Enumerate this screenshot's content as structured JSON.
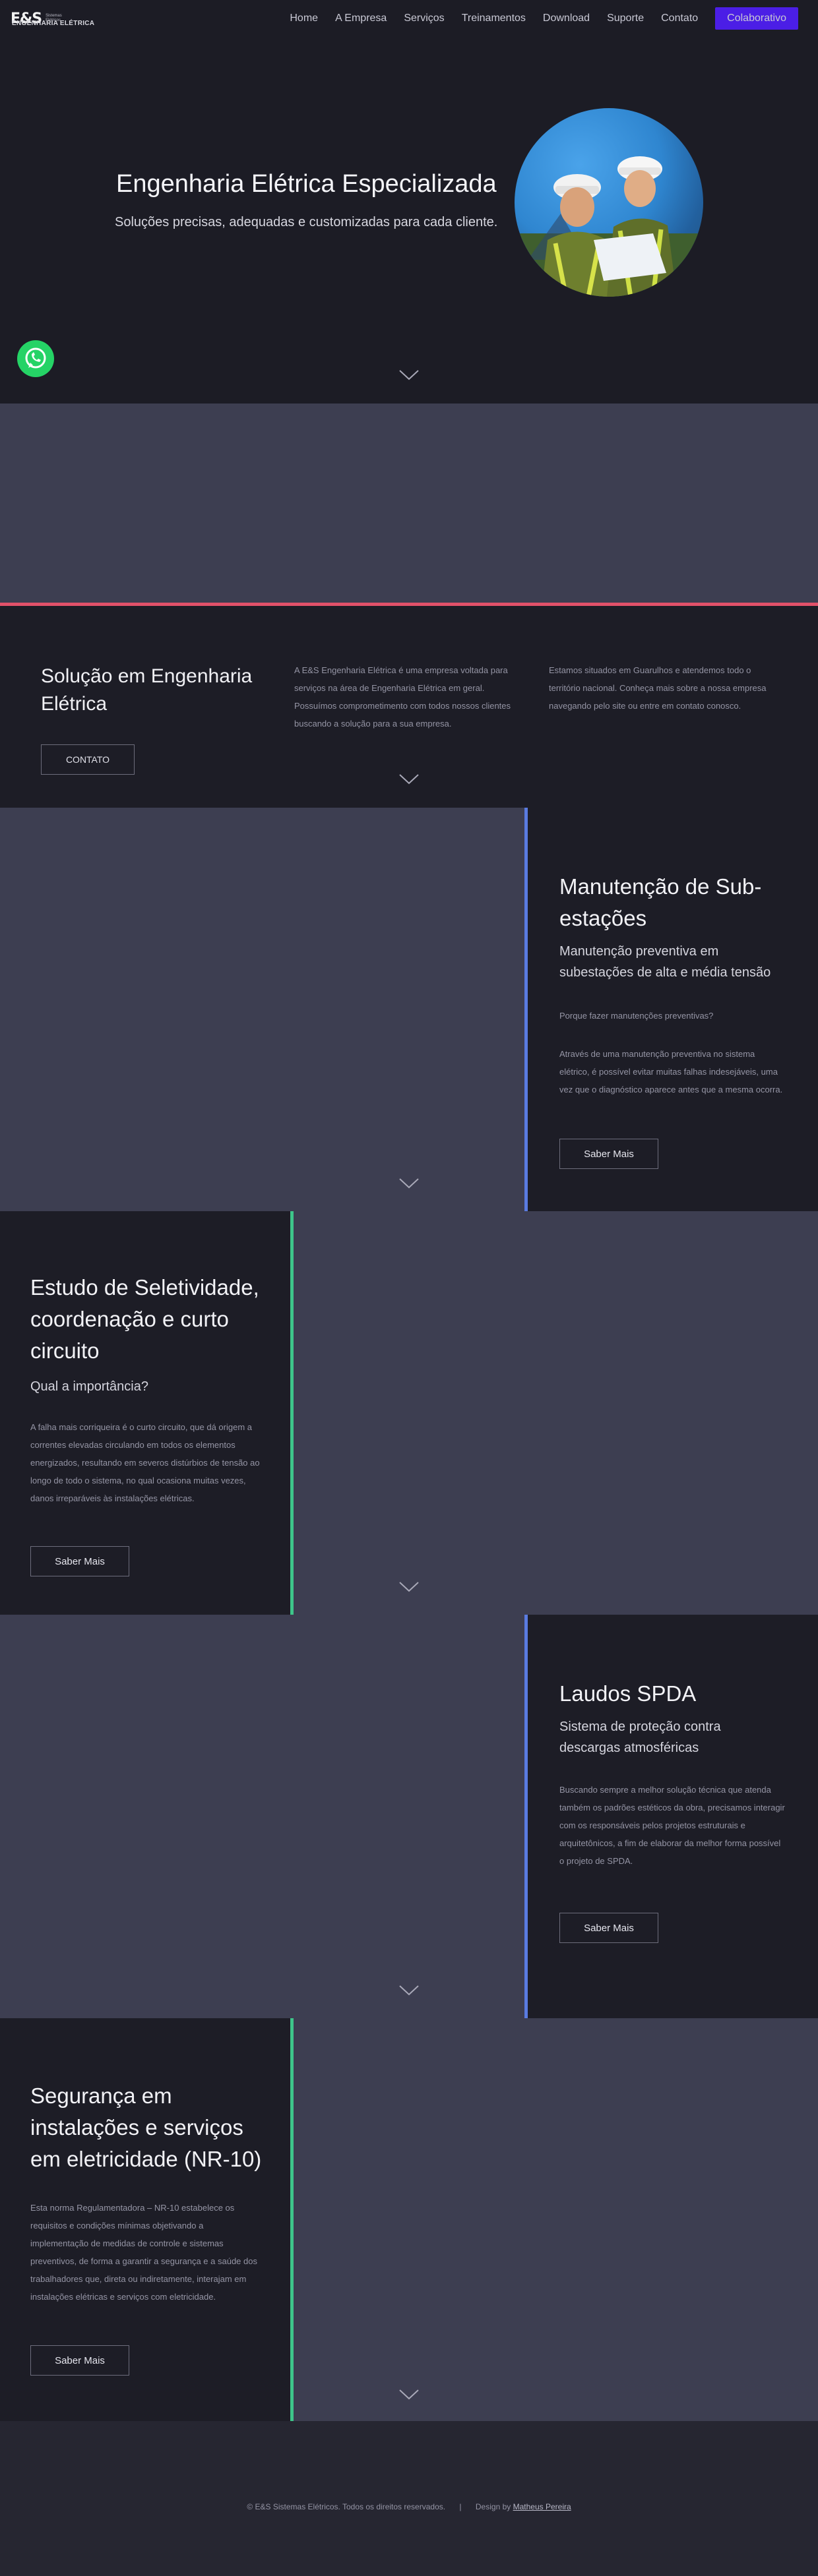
{
  "logo": {
    "mark": "E&S",
    "sub_line1": "Sistemas",
    "sub_line2": "Elétricos",
    "line": "ENGENHARIA ELÉTRICA"
  },
  "nav": {
    "items": [
      "Home",
      "A Empresa",
      "Serviços",
      "Treinamentos",
      "Download",
      "Suporte",
      "Contato"
    ],
    "cta": "Colaborativo"
  },
  "hero": {
    "title": "Engenharia Elétrica Especializada",
    "subtitle": "Soluções precisas, adequadas e customizadas para cada cliente."
  },
  "intro": {
    "title": "Solução em Engenharia Elétrica",
    "button": "CONTATO",
    "col1": "A E&S Engenharia Elétrica é uma empresa voltada para serviços na área de Engenharia Elétrica em geral. Possuímos comprometimento com todos nossos clientes buscando a solução para a sua empresa.",
    "col2": "Estamos situados em Guarulhos e atendemos todo o território nacional. Conheça mais sobre a nossa empresa navegando pelo site ou entre em contato conosco."
  },
  "sections": [
    {
      "title": "Manutenção de Sub-estações",
      "subtitle": "Manutenção preventiva em subestações de alta e média tensão",
      "question": "Porque fazer manutenções preventivas?",
      "text": "Através de uma manutenção preventiva no sistema elétrico, é possível evitar muitas falhas indesejáveis, uma vez que o diagnóstico aparece antes que a mesma ocorra.",
      "button": "Saber Mais",
      "accent": "#5a7be0"
    },
    {
      "title": "Estudo de Seletividade, coordenação e curto circuito",
      "subtitle": "Qual a importância?",
      "text": "A falha mais corriqueira é o curto circuito, que dá origem a correntes elevadas circulando em todos os elementos energizados, resultando em severos distúrbios de tensão ao longo de todo o sistema, no qual ocasiona muitas vezes, danos irreparáveis às instalações elétricas.",
      "button": "Saber Mais",
      "accent": "#3ec58a"
    },
    {
      "title": "Laudos SPDA",
      "subtitle": "Sistema de proteção contra descargas atmosféricas",
      "text": "Buscando sempre a melhor solução técnica que atenda também os padrões estéticos da obra, precisamos interagir com os responsáveis pelos projetos estruturais e arquitetônicos, a fim de elaborar da melhor forma possível o projeto de SPDA.",
      "button": "Saber Mais",
      "accent": "#5a7be0"
    },
    {
      "title": "Segurança em instalações e serviços em eletricidade (NR-10)",
      "text": "Esta norma Regulamentadora – NR-10 estabelece os requisitos e condições mínimas objetivando a implementação de medidas de controle e sistemas preventivos, de forma a garantir a segurança e a saúde dos trabalhadores que, direta ou indiretamente, interajam em instalações elétricas e serviços com eletricidade.",
      "button": "Saber Mais",
      "accent": "#3ec58a"
    }
  ],
  "footer": {
    "copyright": "© E&S Sistemas Elétricos. Todos os direitos reservados.",
    "separator": "|",
    "design_label": "Design by",
    "designer": "Matheus Pereira"
  },
  "icons": [
    "whatsapp-icon",
    "chevron-down-icon",
    "engineers-photo"
  ],
  "colors": {
    "cta": "#4b1ee6",
    "red_line": "#e2516a",
    "blue_accent": "#5a7be0",
    "green_accent": "#3ec58a"
  }
}
